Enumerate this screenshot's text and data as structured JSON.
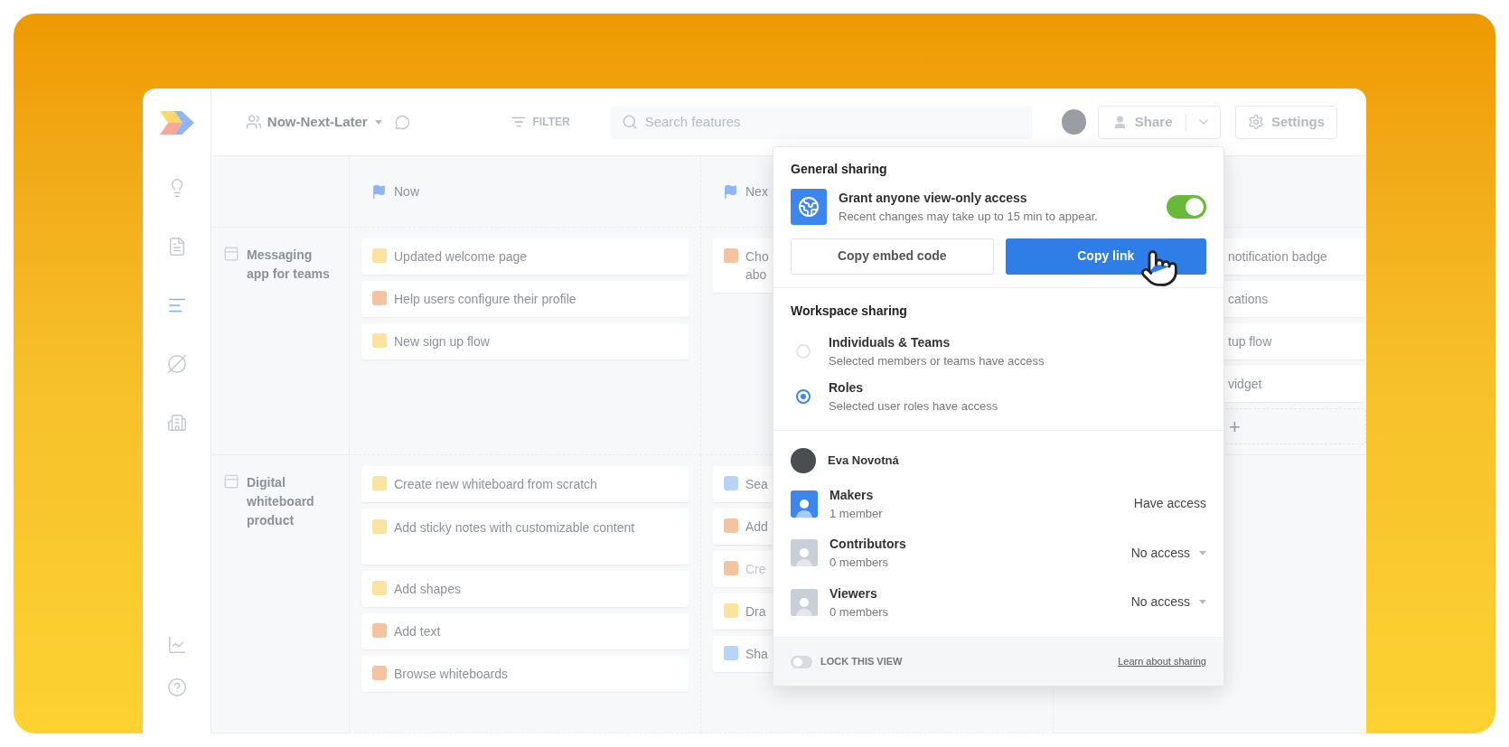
{
  "sidebar": {
    "items": [
      {
        "kind": "bulb",
        "selected": false
      },
      {
        "kind": "notes",
        "selected": false
      },
      {
        "kind": "roadmap",
        "selected": true
      },
      {
        "kind": "slashed",
        "selected": false
      },
      {
        "kind": "building",
        "selected": false
      }
    ],
    "bottom_items": [
      {
        "kind": "chart",
        "selected": false
      },
      {
        "kind": "help",
        "selected": false
      }
    ]
  },
  "toolbar": {
    "board_name": "Now-Next-Later",
    "filter": "FILTER",
    "search": {
      "placeholder": "Search features"
    },
    "share": "Share",
    "settings": "Settings"
  },
  "board": {
    "columns": [
      {
        "title": "Now"
      },
      {
        "title": "Nex"
      }
    ],
    "rows": [
      {
        "title": "Messaging app for teams",
        "cells": [
          {
            "cards": [
              {
                "lines": [
                  "Updated welcome page"
                ],
                "color": "#fbe3a0",
                "faded": false
              },
              {
                "lines": [
                  "Help users configure their profile"
                ],
                "color": "#f6c3a0",
                "faded": false
              },
              {
                "lines": [
                  "New sign up flow"
                ],
                "color": "#fbe3a0",
                "faded": false
              }
            ]
          },
          {
            "cards": [
              {
                "lines": [
                  "Cho",
                  "abo"
                ],
                "color": "#f6c3a0",
                "faded": false
              }
            ]
          },
          {
            "cards": [
              {
                "lines": [
                  "notification badge"
                ],
                "faded": false
              },
              {
                "lines": [
                  "cations"
                ],
                "faded": false
              },
              {
                "lines": [
                  "tup flow"
                ],
                "faded": false
              },
              {
                "lines": [
                  "vidget"
                ],
                "faded": false
              }
            ],
            "add": "+"
          }
        ]
      },
      {
        "title": "Digital whiteboard product",
        "cells": [
          {
            "cards": [
              {
                "lines": [
                  "Create new whiteboard from scratch"
                ],
                "color": "#fbe3a0",
                "faded": false
              },
              {
                "lines": [
                  "Add sticky notes with customizable content"
                ],
                "color": "#fbe3a0",
                "faded": false,
                "tall": true
              },
              {
                "lines": [
                  "Add shapes"
                ],
                "color": "#fbe3a0",
                "faded": false
              },
              {
                "lines": [
                  "Add text"
                ],
                "color": "#f6c3a0",
                "faded": false
              },
              {
                "lines": [
                  "Browse whiteboards"
                ],
                "color": "#f6c3a0",
                "faded": false
              }
            ]
          },
          {
            "cards": [
              {
                "lines": [
                  "Sea"
                ],
                "color": "#b9d4fb",
                "faded": false
              },
              {
                "lines": [
                  "Add"
                ],
                "color": "#f6c3a0",
                "faded": false
              },
              {
                "lines": [
                  "Cre"
                ],
                "color": "#f6c3a0",
                "faded": true
              },
              {
                "lines": [
                  "Dra"
                ],
                "color": "#fbe3a0",
                "faded": false
              },
              {
                "lines": [
                  "Sha"
                ],
                "color": "#b9d4fb",
                "faded": false
              }
            ]
          }
        ]
      }
    ]
  },
  "share_popup": {
    "general": {
      "title": "General sharing",
      "option": {
        "title": "Grant anyone view-only access",
        "subtitle": "Recent changes may take up to 15 min to appear.",
        "on": true
      },
      "buttons": [
        {
          "label": "Copy embed code",
          "kind": "secondary"
        },
        {
          "label": "Copy link",
          "kind": "primary"
        }
      ]
    },
    "workspace": {
      "title": "Workspace sharing",
      "options": [
        {
          "title": "Individuals & Teams",
          "subtitle": "Selected members or teams have access",
          "selected": false
        },
        {
          "title": "Roles",
          "subtitle": "Selected user roles have access",
          "selected": true
        }
      ]
    },
    "owner": {
      "name": "Eva Novotná"
    },
    "roles": [
      {
        "name": "Makers",
        "count": "1 member",
        "access": "Have access",
        "active": true,
        "dropdown": false
      },
      {
        "name": "Contributors",
        "count": "0 members",
        "access": "No access",
        "active": false,
        "dropdown": true
      },
      {
        "name": "Viewers",
        "count": "0 members",
        "access": "No access",
        "active": false,
        "dropdown": true
      }
    ],
    "footer": {
      "lock": {
        "label": "LOCK THIS VIEW",
        "on": false
      },
      "link": "Learn about sharing"
    }
  }
}
